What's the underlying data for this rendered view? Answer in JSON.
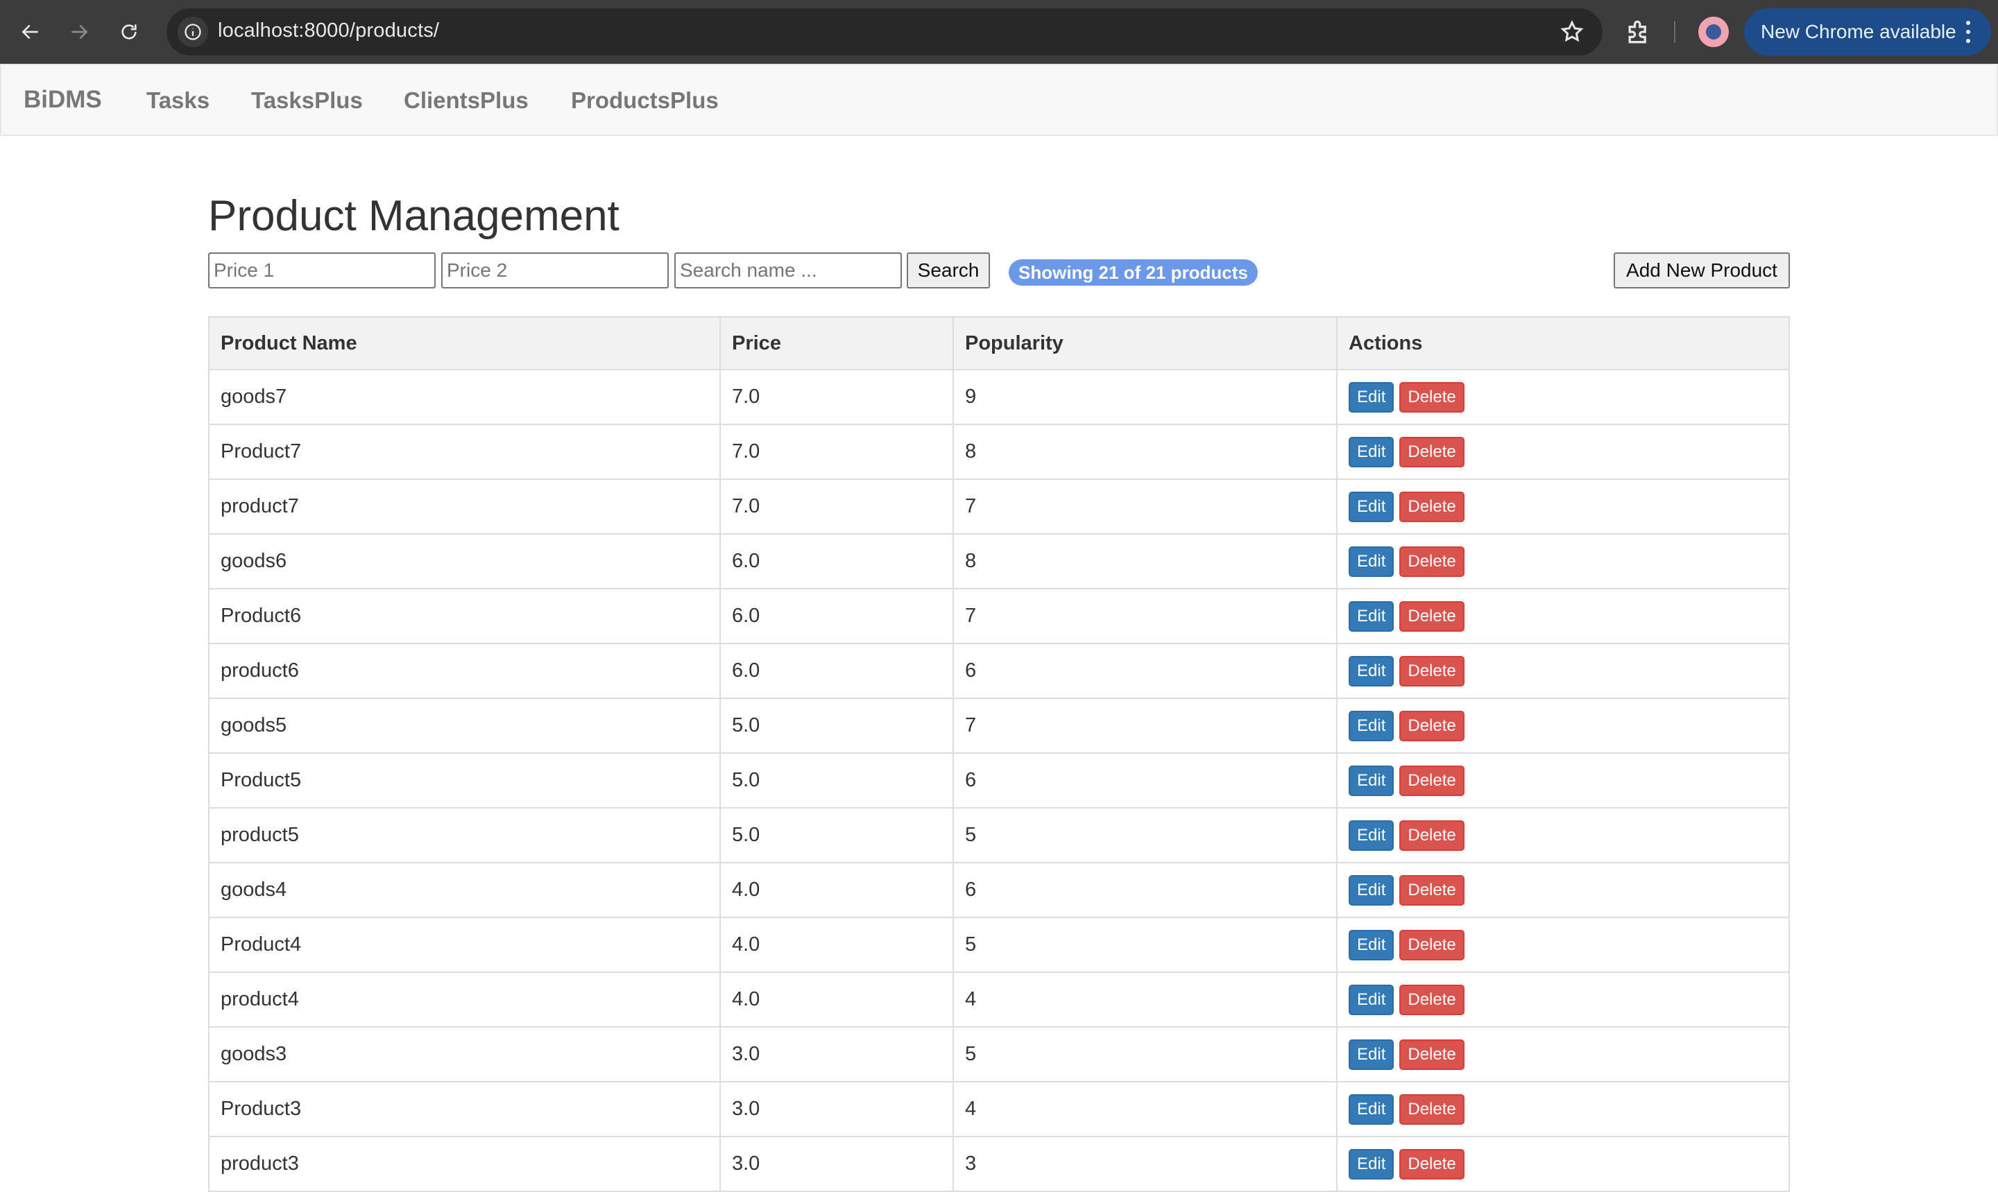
{
  "browser": {
    "url": "localhost:8000/products/",
    "update_label": "New Chrome available"
  },
  "navbar": {
    "brand": "BiDMS",
    "links": [
      "Tasks",
      "TasksPlus",
      "ClientsPlus",
      "ProductsPlus"
    ]
  },
  "main": {
    "title": "Product Management",
    "filters": {
      "price1_placeholder": "Price 1",
      "price2_placeholder": "Price 2",
      "search_placeholder": "Search name ...",
      "search_button": "Search"
    },
    "count_badge": "Showing 21 of 21 products",
    "add_button": "Add New Product"
  },
  "table": {
    "headers": [
      "Product Name",
      "Price",
      "Popularity",
      "Actions"
    ],
    "edit_label": "Edit",
    "delete_label": "Delete",
    "rows": [
      {
        "name": "goods7",
        "price": "7.0",
        "popularity": "9"
      },
      {
        "name": "Product7",
        "price": "7.0",
        "popularity": "8"
      },
      {
        "name": "product7",
        "price": "7.0",
        "popularity": "7"
      },
      {
        "name": "goods6",
        "price": "6.0",
        "popularity": "8"
      },
      {
        "name": "Product6",
        "price": "6.0",
        "popularity": "7"
      },
      {
        "name": "product6",
        "price": "6.0",
        "popularity": "6"
      },
      {
        "name": "goods5",
        "price": "5.0",
        "popularity": "7"
      },
      {
        "name": "Product5",
        "price": "5.0",
        "popularity": "6"
      },
      {
        "name": "product5",
        "price": "5.0",
        "popularity": "5"
      },
      {
        "name": "goods4",
        "price": "4.0",
        "popularity": "6"
      },
      {
        "name": "Product4",
        "price": "4.0",
        "popularity": "5"
      },
      {
        "name": "product4",
        "price": "4.0",
        "popularity": "4"
      },
      {
        "name": "goods3",
        "price": "3.0",
        "popularity": "5"
      },
      {
        "name": "Product3",
        "price": "3.0",
        "popularity": "4"
      },
      {
        "name": "product3",
        "price": "3.0",
        "popularity": "3"
      }
    ]
  },
  "colors": {
    "edit": "#337ab7",
    "delete": "#d9534f",
    "badge": "#6b98e8",
    "update_pill": "#1e4b8a"
  },
  "icons": [
    "back-icon",
    "forward-icon",
    "reload-icon",
    "site-info-icon",
    "star-icon",
    "extensions-icon",
    "profile-icon",
    "more-icon"
  ]
}
